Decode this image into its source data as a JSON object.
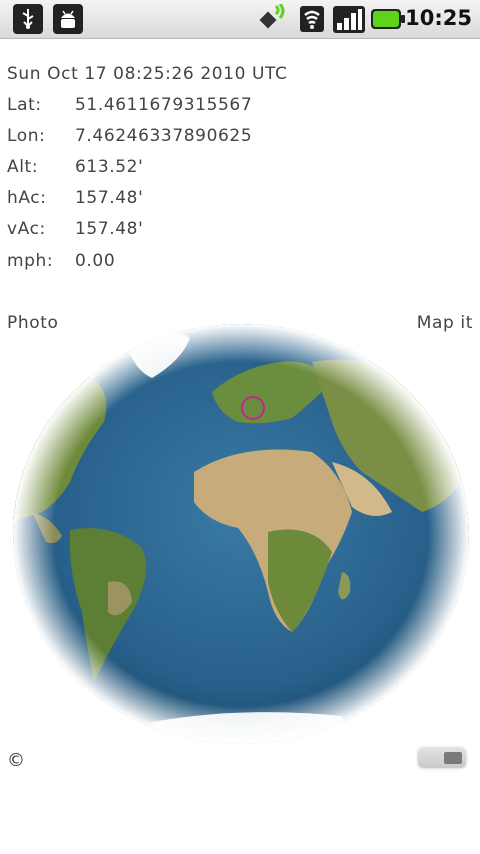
{
  "status_bar": {
    "time": "10:25",
    "icons": [
      "usb-icon",
      "debug-android-icon",
      "gps-satellite-icon",
      "wifi-icon",
      "cell-signal-icon",
      "battery-icon"
    ],
    "battery_color": "#5ed31a"
  },
  "info": {
    "datetime": "Sun Oct 17 08:25:26 2010 UTC",
    "rows": [
      {
        "label": "Lat:",
        "value": "51.4611679315567"
      },
      {
        "label": "Lon:",
        "value": "7.46246337890625"
      },
      {
        "label": "Alt:",
        "value": "613.52'"
      },
      {
        "label": "hAc:",
        "value": "157.48'"
      },
      {
        "label": "vAc:",
        "value": "157.48'"
      },
      {
        "label": "mph:",
        "value": "0.00"
      }
    ]
  },
  "actions": {
    "photo": "Photo",
    "map_it": "Map it"
  },
  "globe": {
    "marker_color": "#c0288e",
    "ocean_color": "#27608a",
    "land_color": "#6f8a3a"
  },
  "footer": {
    "copyright": "©"
  }
}
